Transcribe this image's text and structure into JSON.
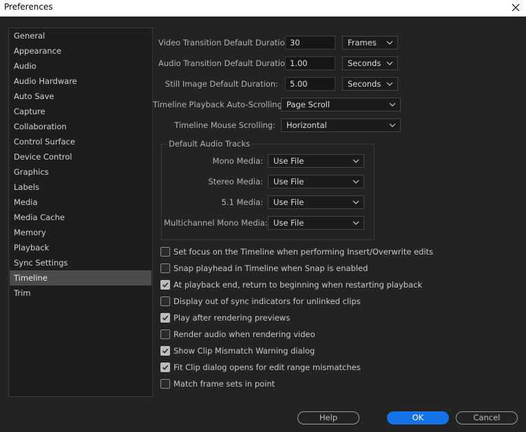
{
  "window": {
    "title": "Preferences"
  },
  "sidebar": {
    "items": [
      {
        "label": "General"
      },
      {
        "label": "Appearance"
      },
      {
        "label": "Audio"
      },
      {
        "label": "Audio Hardware"
      },
      {
        "label": "Auto Save"
      },
      {
        "label": "Capture"
      },
      {
        "label": "Collaboration"
      },
      {
        "label": "Control Surface"
      },
      {
        "label": "Device Control"
      },
      {
        "label": "Graphics"
      },
      {
        "label": "Labels"
      },
      {
        "label": "Media"
      },
      {
        "label": "Media Cache"
      },
      {
        "label": "Memory"
      },
      {
        "label": "Playback"
      },
      {
        "label": "Sync Settings"
      },
      {
        "label": "Timeline",
        "selected": true
      },
      {
        "label": "Trim"
      }
    ]
  },
  "durations": {
    "video": {
      "label": "Video Transition Default Duration:",
      "value": "30",
      "unit": "Frames"
    },
    "audio": {
      "label": "Audio Transition Default Duration:",
      "value": "1.00",
      "unit": "Seconds"
    },
    "still": {
      "label": "Still Image Default Duration:",
      "value": "5.00",
      "unit": "Seconds"
    }
  },
  "scrolling": {
    "playback": {
      "label": "Timeline Playback Auto-Scrolling:",
      "value": "Page Scroll"
    },
    "mouse": {
      "label": "Timeline Mouse Scrolling:",
      "value": "Horizontal"
    }
  },
  "audio_tracks": {
    "title": "Default Audio Tracks",
    "mono": {
      "label": "Mono Media:",
      "value": "Use File"
    },
    "stereo": {
      "label": "Stereo Media:",
      "value": "Use File"
    },
    "five_one": {
      "label": "5.1 Media:",
      "value": "Use File"
    },
    "multichannel": {
      "label": "Multichannel Mono Media:",
      "value": "Use File"
    }
  },
  "options": [
    {
      "label": "Set focus on the Timeline when performing Insert/Overwrite edits",
      "checked": false
    },
    {
      "label": "Snap playhead in Timeline when Snap is enabled",
      "checked": false
    },
    {
      "label": "At playback end, return to beginning when restarting playback",
      "checked": true
    },
    {
      "label": "Display out of sync indicators for unlinked clips",
      "checked": false
    },
    {
      "label": "Play after rendering previews",
      "checked": true
    },
    {
      "label": "Render audio when rendering video",
      "checked": false
    },
    {
      "label": "Show Clip Mismatch Warning dialog",
      "checked": true
    },
    {
      "label": "Fit Clip dialog opens for edit range mismatches",
      "checked": true
    },
    {
      "label": "Match frame sets in point",
      "checked": false
    }
  ],
  "buttons": {
    "help": "Help",
    "ok": "OK",
    "cancel": "Cancel"
  },
  "colors": {
    "accent": "#1473e6",
    "background": "#232323",
    "selected": "#4b4b4b"
  }
}
